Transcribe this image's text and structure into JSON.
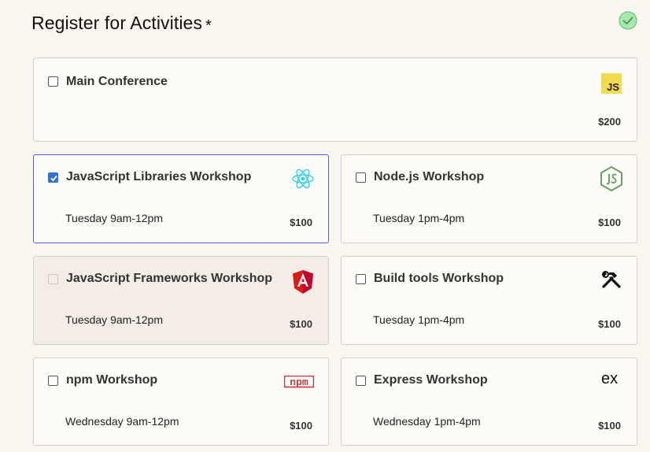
{
  "header": {
    "title": "Register for Activities",
    "required_marker": "*"
  },
  "activities": [
    {
      "name": "Main Conference",
      "time": "",
      "price": "$200",
      "checked": false,
      "disabled": false,
      "icon": "js-icon"
    },
    {
      "name": "JavaScript Libraries Workshop",
      "time": "Tuesday 9am-12pm",
      "price": "$100",
      "checked": true,
      "disabled": false,
      "icon": "react-icon"
    },
    {
      "name": "Node.js Workshop",
      "time": "Tuesday 1pm-4pm",
      "price": "$100",
      "checked": false,
      "disabled": false,
      "icon": "nodejs-icon"
    },
    {
      "name": "JavaScript Frameworks Workshop",
      "time": "Tuesday 9am-12pm",
      "price": "$100",
      "checked": false,
      "disabled": true,
      "icon": "angular-icon"
    },
    {
      "name": "Build tools Workshop",
      "time": "Tuesday 1pm-4pm",
      "price": "$100",
      "checked": false,
      "disabled": false,
      "icon": "tools-icon"
    },
    {
      "name": "npm Workshop",
      "time": "Wednesday 9am-12pm",
      "price": "$100",
      "checked": false,
      "disabled": false,
      "icon": "npm-icon"
    },
    {
      "name": "Express Workshop",
      "time": "Wednesday 1pm-4pm",
      "price": "$100",
      "checked": false,
      "disabled": false,
      "icon": "express-icon"
    }
  ],
  "logo_text": {
    "js": "JS",
    "npm": "npm",
    "express": "ex"
  },
  "colors": {
    "accent": "#2f6fd6",
    "selected_border": "#5a5fcf",
    "valid_green": "#7fd68a",
    "js_yellow": "#f0db4f",
    "react_cyan": "#2fd0f0",
    "node_green": "#68a063",
    "angular_red": "#dd1b16",
    "npm_red": "#cb3837"
  }
}
